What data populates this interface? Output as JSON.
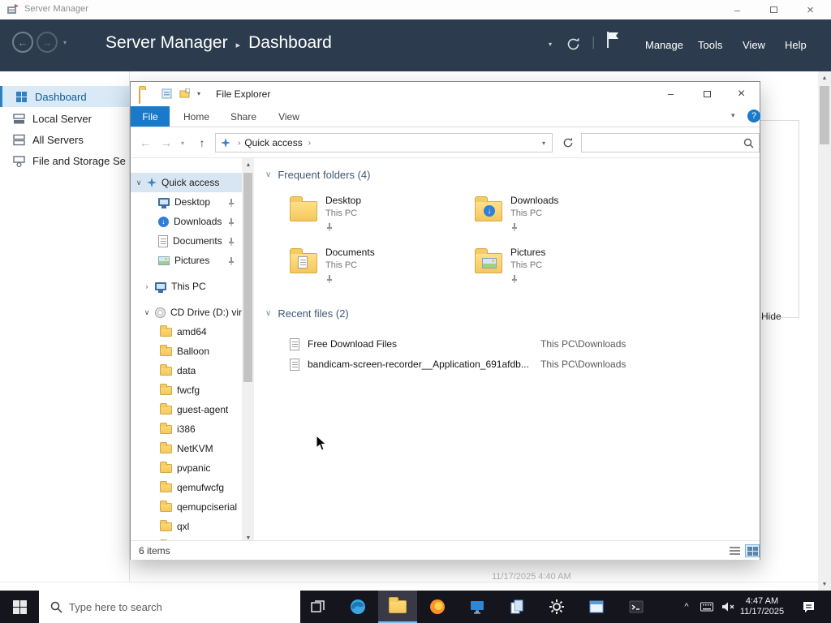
{
  "window": {
    "title": "Server Manager"
  },
  "header": {
    "app": "Server Manager",
    "sep": "▸",
    "page": "Dashboard",
    "menu": [
      "Manage",
      "Tools",
      "View",
      "Help"
    ]
  },
  "sidebar": {
    "items": [
      "Dashboard",
      "Local Server",
      "All Servers",
      "File and Storage Se"
    ]
  },
  "content": {
    "hide_link": "Hide",
    "faint_clock": "11/17/2025 4:40 AM"
  },
  "explorer": {
    "title": "File Explorer",
    "tabs": [
      "File",
      "Home",
      "Share",
      "View"
    ],
    "address": {
      "crumb": "Quick access"
    },
    "nav": {
      "quick_access": "Quick access",
      "qa_children": [
        "Desktop",
        "Downloads",
        "Documents",
        "Pictures"
      ],
      "this_pc": "This PC",
      "drive": "CD Drive (D:) virtio",
      "folders": [
        "amd64",
        "Balloon",
        "data",
        "fwcfg",
        "guest-agent",
        "i386",
        "NetKVM",
        "pvpanic",
        "qemufwcfg",
        "qemupciserial",
        "qxl"
      ]
    },
    "frequent": {
      "title": "Frequent folders (4)",
      "items": [
        {
          "name": "Desktop",
          "location": "This PC"
        },
        {
          "name": "Downloads",
          "location": "This PC"
        },
        {
          "name": "Documents",
          "location": "This PC"
        },
        {
          "name": "Pictures",
          "location": "This PC"
        }
      ]
    },
    "recent": {
      "title": "Recent files (2)",
      "items": [
        {
          "name": "Free Download Files",
          "location": "This PC\\Downloads"
        },
        {
          "name": "bandicam-screen-recorder__Application_691afdb...",
          "location": "This PC\\Downloads"
        }
      ]
    },
    "status": "6 items"
  },
  "taskbar": {
    "search_placeholder": "Type here to search",
    "time": "4:47 AM",
    "date": "11/17/2025"
  },
  "glyphs": {
    "minimize": "–",
    "close": "×",
    "caret_down": "▾",
    "chevron_expanded": "∨",
    "chevron_collapsed": "›",
    "back": "←",
    "forward": "→",
    "up": "↑",
    "pipe": "|",
    "scroll_up": "▲",
    "scroll_down": "▼",
    "tray_chevron": "^",
    "down_arrow": "↓",
    "help": "?"
  }
}
